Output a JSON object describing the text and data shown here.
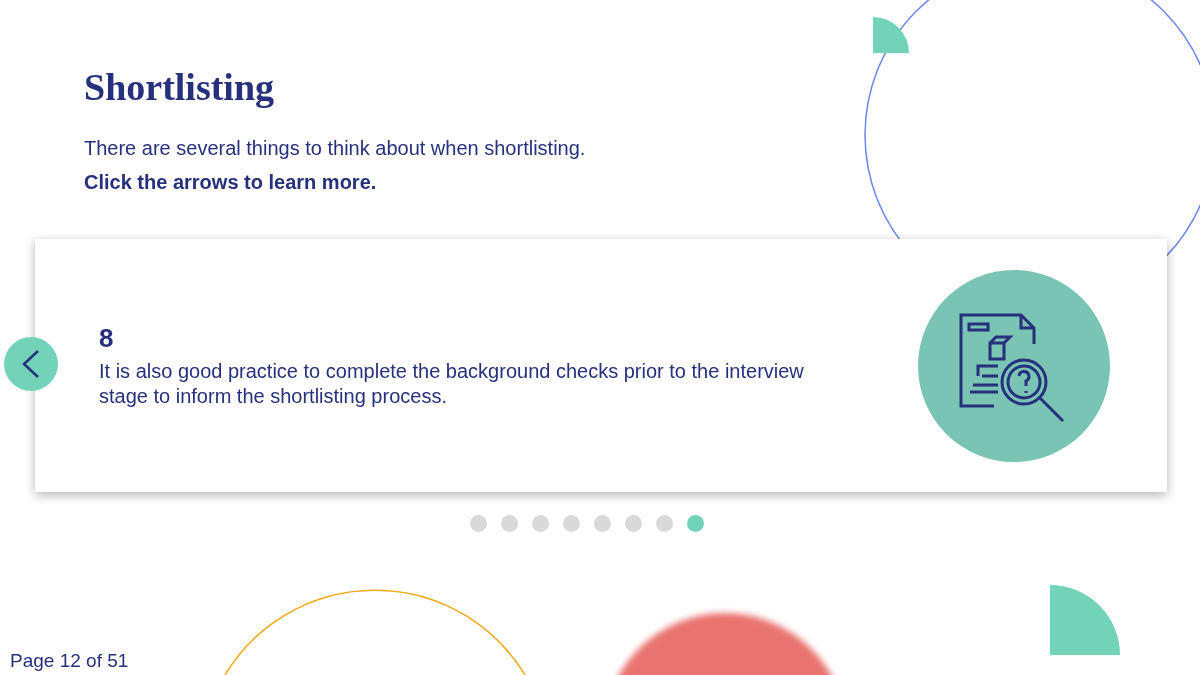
{
  "title": "Shortlisting",
  "intro": "There are several things to think about when shortlisting.",
  "instruction": "Click the arrows to learn more.",
  "card": {
    "number": "8",
    "text": "It is also good practice to complete the background checks prior to the interview stage to inform the shortlisting process."
  },
  "slides": [
    {
      "selected": false
    },
    {
      "selected": false
    },
    {
      "selected": false
    },
    {
      "selected": false
    },
    {
      "selected": false
    },
    {
      "selected": false
    },
    {
      "selected": false
    },
    {
      "selected": true
    }
  ],
  "footer": "Page 12 of 51"
}
